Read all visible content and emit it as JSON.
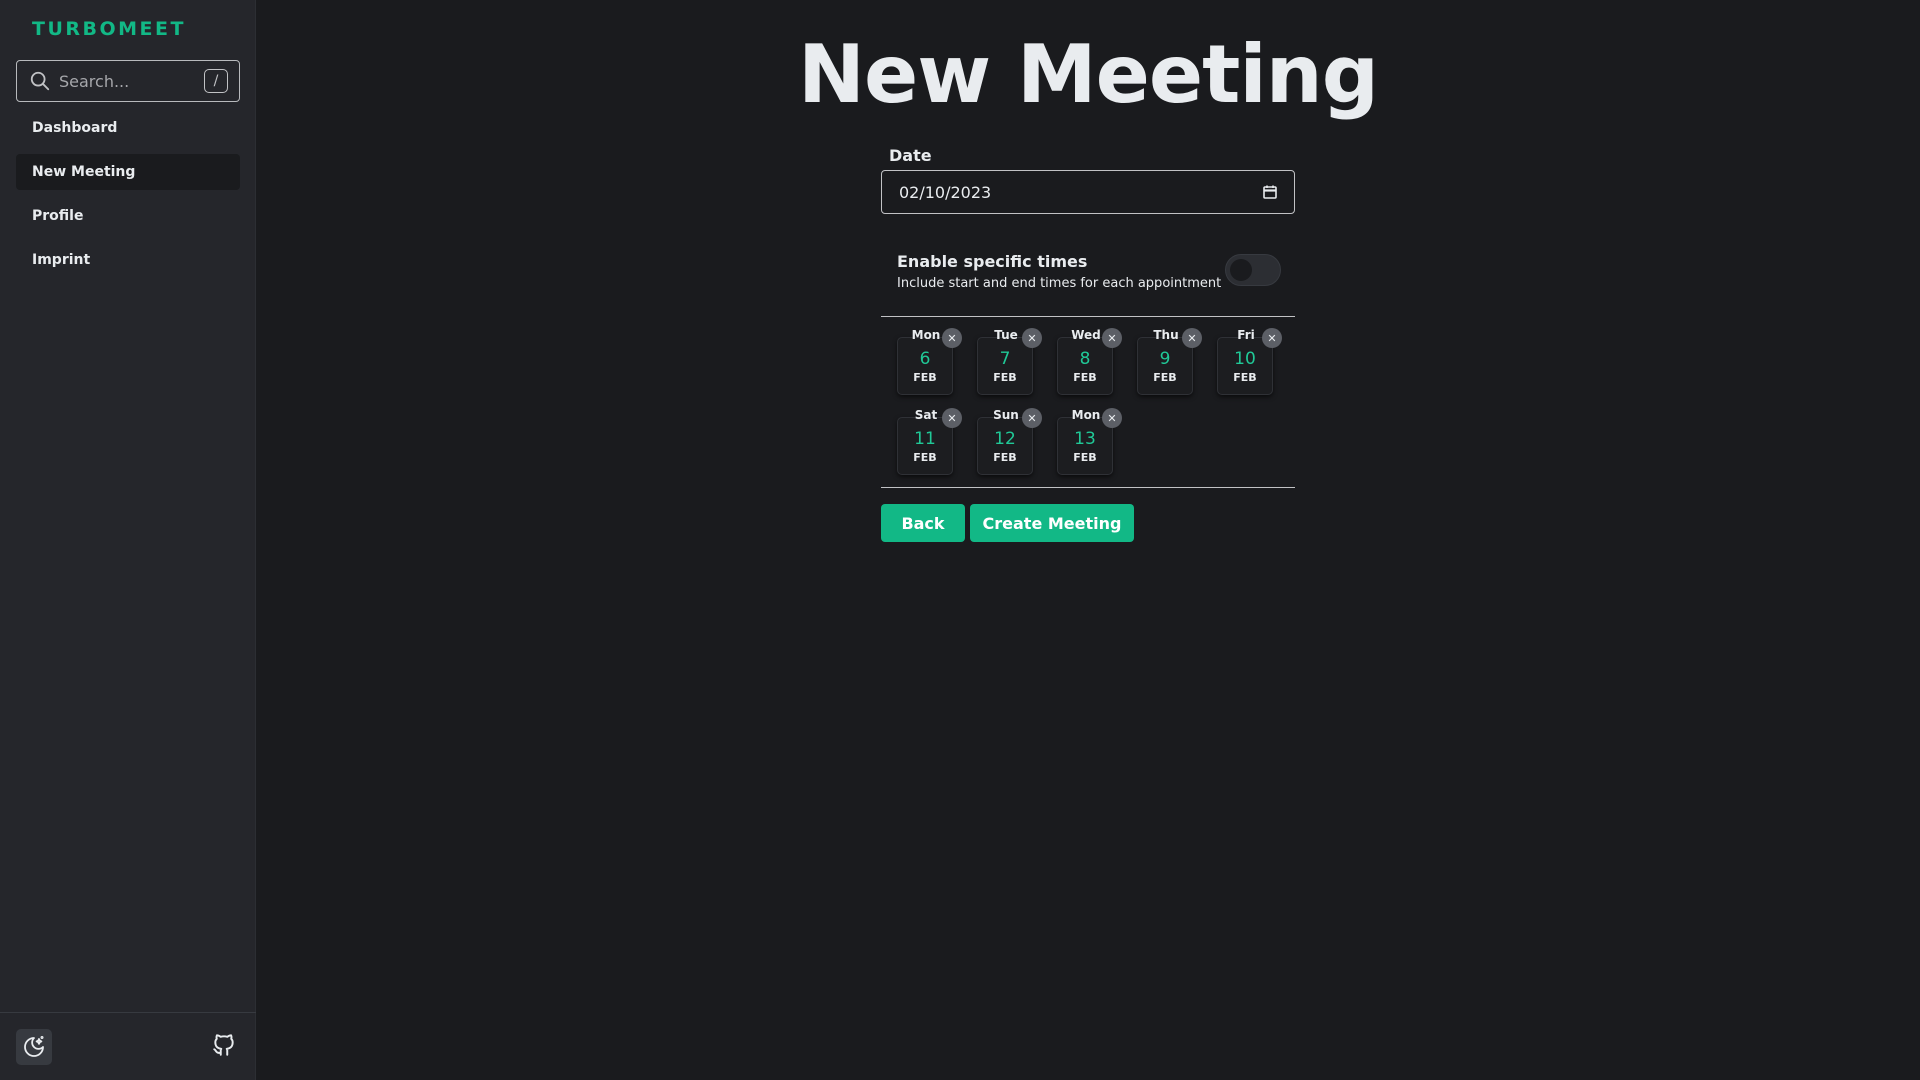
{
  "app": {
    "brand": "TURBOMEET"
  },
  "search": {
    "placeholder": "Search...",
    "shortcut": "/"
  },
  "sidebar": {
    "items": [
      {
        "label": "Dashboard",
        "active": false
      },
      {
        "label": "New Meeting",
        "active": true
      },
      {
        "label": "Profile",
        "active": false
      },
      {
        "label": "Imprint",
        "active": false
      }
    ],
    "footer": {
      "theme_icon": "moon-stars-icon",
      "repo_icon": "github-icon"
    }
  },
  "main": {
    "title": "New Meeting",
    "date_field": {
      "label": "Date",
      "value": "02/10/2023",
      "icon": "calendar-icon"
    },
    "times_switch": {
      "title": "Enable specific times",
      "description": "Include start and end times for each appointment",
      "enabled": false
    },
    "dates": [
      {
        "dow": "Mon",
        "day": "6",
        "month": "FEB"
      },
      {
        "dow": "Tue",
        "day": "7",
        "month": "FEB"
      },
      {
        "dow": "Wed",
        "day": "8",
        "month": "FEB"
      },
      {
        "dow": "Thu",
        "day": "9",
        "month": "FEB"
      },
      {
        "dow": "Fri",
        "day": "10",
        "month": "FEB"
      },
      {
        "dow": "Sat",
        "day": "11",
        "month": "FEB"
      },
      {
        "dow": "Sun",
        "day": "12",
        "month": "FEB"
      },
      {
        "dow": "Mon",
        "day": "13",
        "month": "FEB"
      }
    ],
    "remove_glyph": "✕",
    "actions": {
      "back_label": "Back",
      "create_label": "Create Meeting"
    }
  },
  "colors": {
    "accent": "#12b886",
    "date_number": "#20c997",
    "background": "#1a1b1e",
    "sidebar": "#25262b"
  }
}
